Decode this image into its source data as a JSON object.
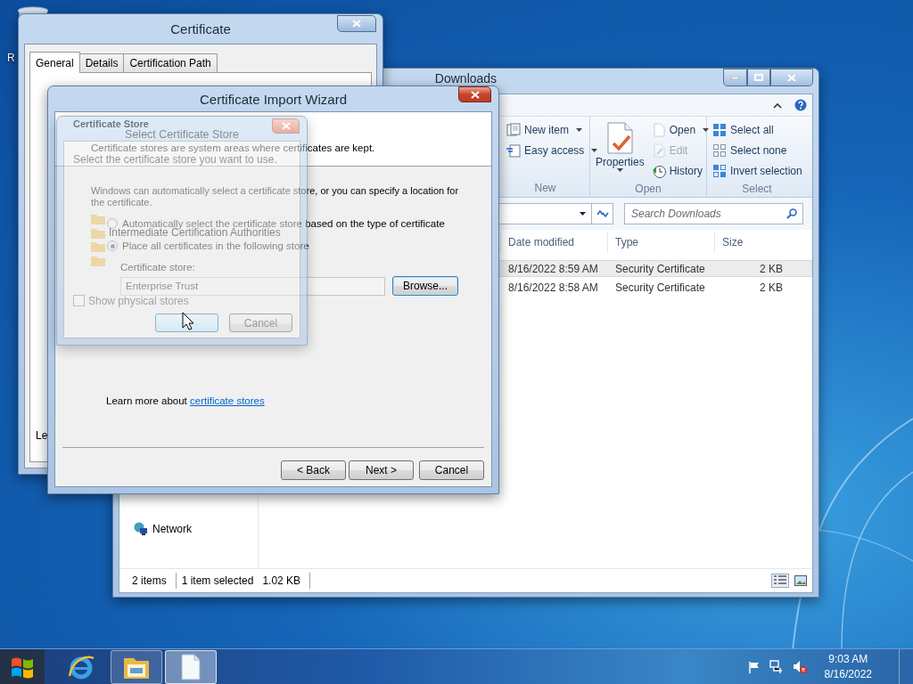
{
  "desktop": {
    "icon_label": "R"
  },
  "certificate_window": {
    "title": "Certificate",
    "tabs": [
      {
        "label": "General",
        "selected": true
      },
      {
        "label": "Details",
        "selected": false
      },
      {
        "label": "Certification Path",
        "selected": false
      }
    ],
    "panel_text": "Le"
  },
  "explorer": {
    "title": "Downloads",
    "ribbon_groups": [
      {
        "label": "New",
        "items": [
          {
            "kind": "sheets",
            "label": "New item",
            "dropdown": true,
            "disabled": false
          },
          {
            "kind": "pin",
            "label": "Easy access",
            "dropdown": true,
            "disabled": false
          }
        ]
      },
      {
        "label": "Open",
        "items": [
          {
            "kind": "properties",
            "label": "Properties",
            "dropdown": true,
            "disabled": false
          },
          {
            "kind": "page",
            "label": "Open",
            "dropdown": true,
            "disabled": false
          },
          {
            "kind": "edit",
            "label": "Edit",
            "dropdown": false,
            "disabled": true
          },
          {
            "kind": "clock",
            "label": "History",
            "dropdown": false,
            "disabled": false
          }
        ]
      },
      {
        "label": "Select",
        "items": [
          {
            "kind": "grid",
            "label": "Select all",
            "dropdown": false,
            "disabled": false
          },
          {
            "kind": "emptygrid",
            "label": "Select none",
            "dropdown": false,
            "disabled": false
          },
          {
            "kind": "invert",
            "label": "Invert selection",
            "dropdown": false,
            "disabled": false
          }
        ]
      }
    ],
    "search": {
      "placeholder": "Search Downloads"
    },
    "columns": [
      "Date modified",
      "Type",
      "Size"
    ],
    "rows": [
      {
        "date": "8/16/2022 8:59 AM",
        "type": "Security Certificate",
        "size": "2 KB",
        "selected": true
      },
      {
        "date": "8/16/2022 8:58 AM",
        "type": "Security Certificate",
        "size": "2 KB",
        "selected": false
      }
    ],
    "navigation": [
      {
        "label": "Network"
      }
    ],
    "status_bar": {
      "item_count": "2 items",
      "selection": "1 item selected",
      "selection_size": "1.02 KB"
    }
  },
  "wizard": {
    "title": "Certificate Import Wizard",
    "heading": "Certificate Store",
    "subheading": "Certificate stores are system areas where certificates are kept.",
    "intro": "Windows can automatically select a certificate store, or you can specify a location for the certificate.",
    "options": [
      {
        "label": "Automatically select the certificate store based on the type of certificate",
        "selected": false
      },
      {
        "label": "Place all certificates in the following store",
        "selected": true
      }
    ],
    "store_label": "Certificate store:",
    "store_value": "Enterprise Trust",
    "browse_button": "Browse...",
    "learn_more": "Learn more about",
    "learn_more_link": "certificate stores",
    "buttons": [
      "< Back",
      "Next >",
      "Cancel"
    ]
  },
  "store_dialog": {
    "title": "Select Certificate Store",
    "instruction": "Select the certificate store you want to use.",
    "stores": [
      {
        "kind": "folder"
      },
      {
        "kind": "folder",
        "label": "Intermediate Certification Authorities"
      },
      {
        "kind": "folder"
      },
      {
        "kind": "folder"
      }
    ],
    "checkbox": {
      "label": "Show physical stores",
      "checked": false
    },
    "cancel_button": "Cancel"
  },
  "taskbar": {
    "buttons": [
      {
        "kind": "browser",
        "running": false,
        "selected": false
      },
      {
        "kind": "folder",
        "running": true,
        "selected": false
      },
      {
        "kind": "document",
        "running": true,
        "selected": true
      }
    ],
    "time": "9:03 AM",
    "date": "8/16/2022"
  }
}
